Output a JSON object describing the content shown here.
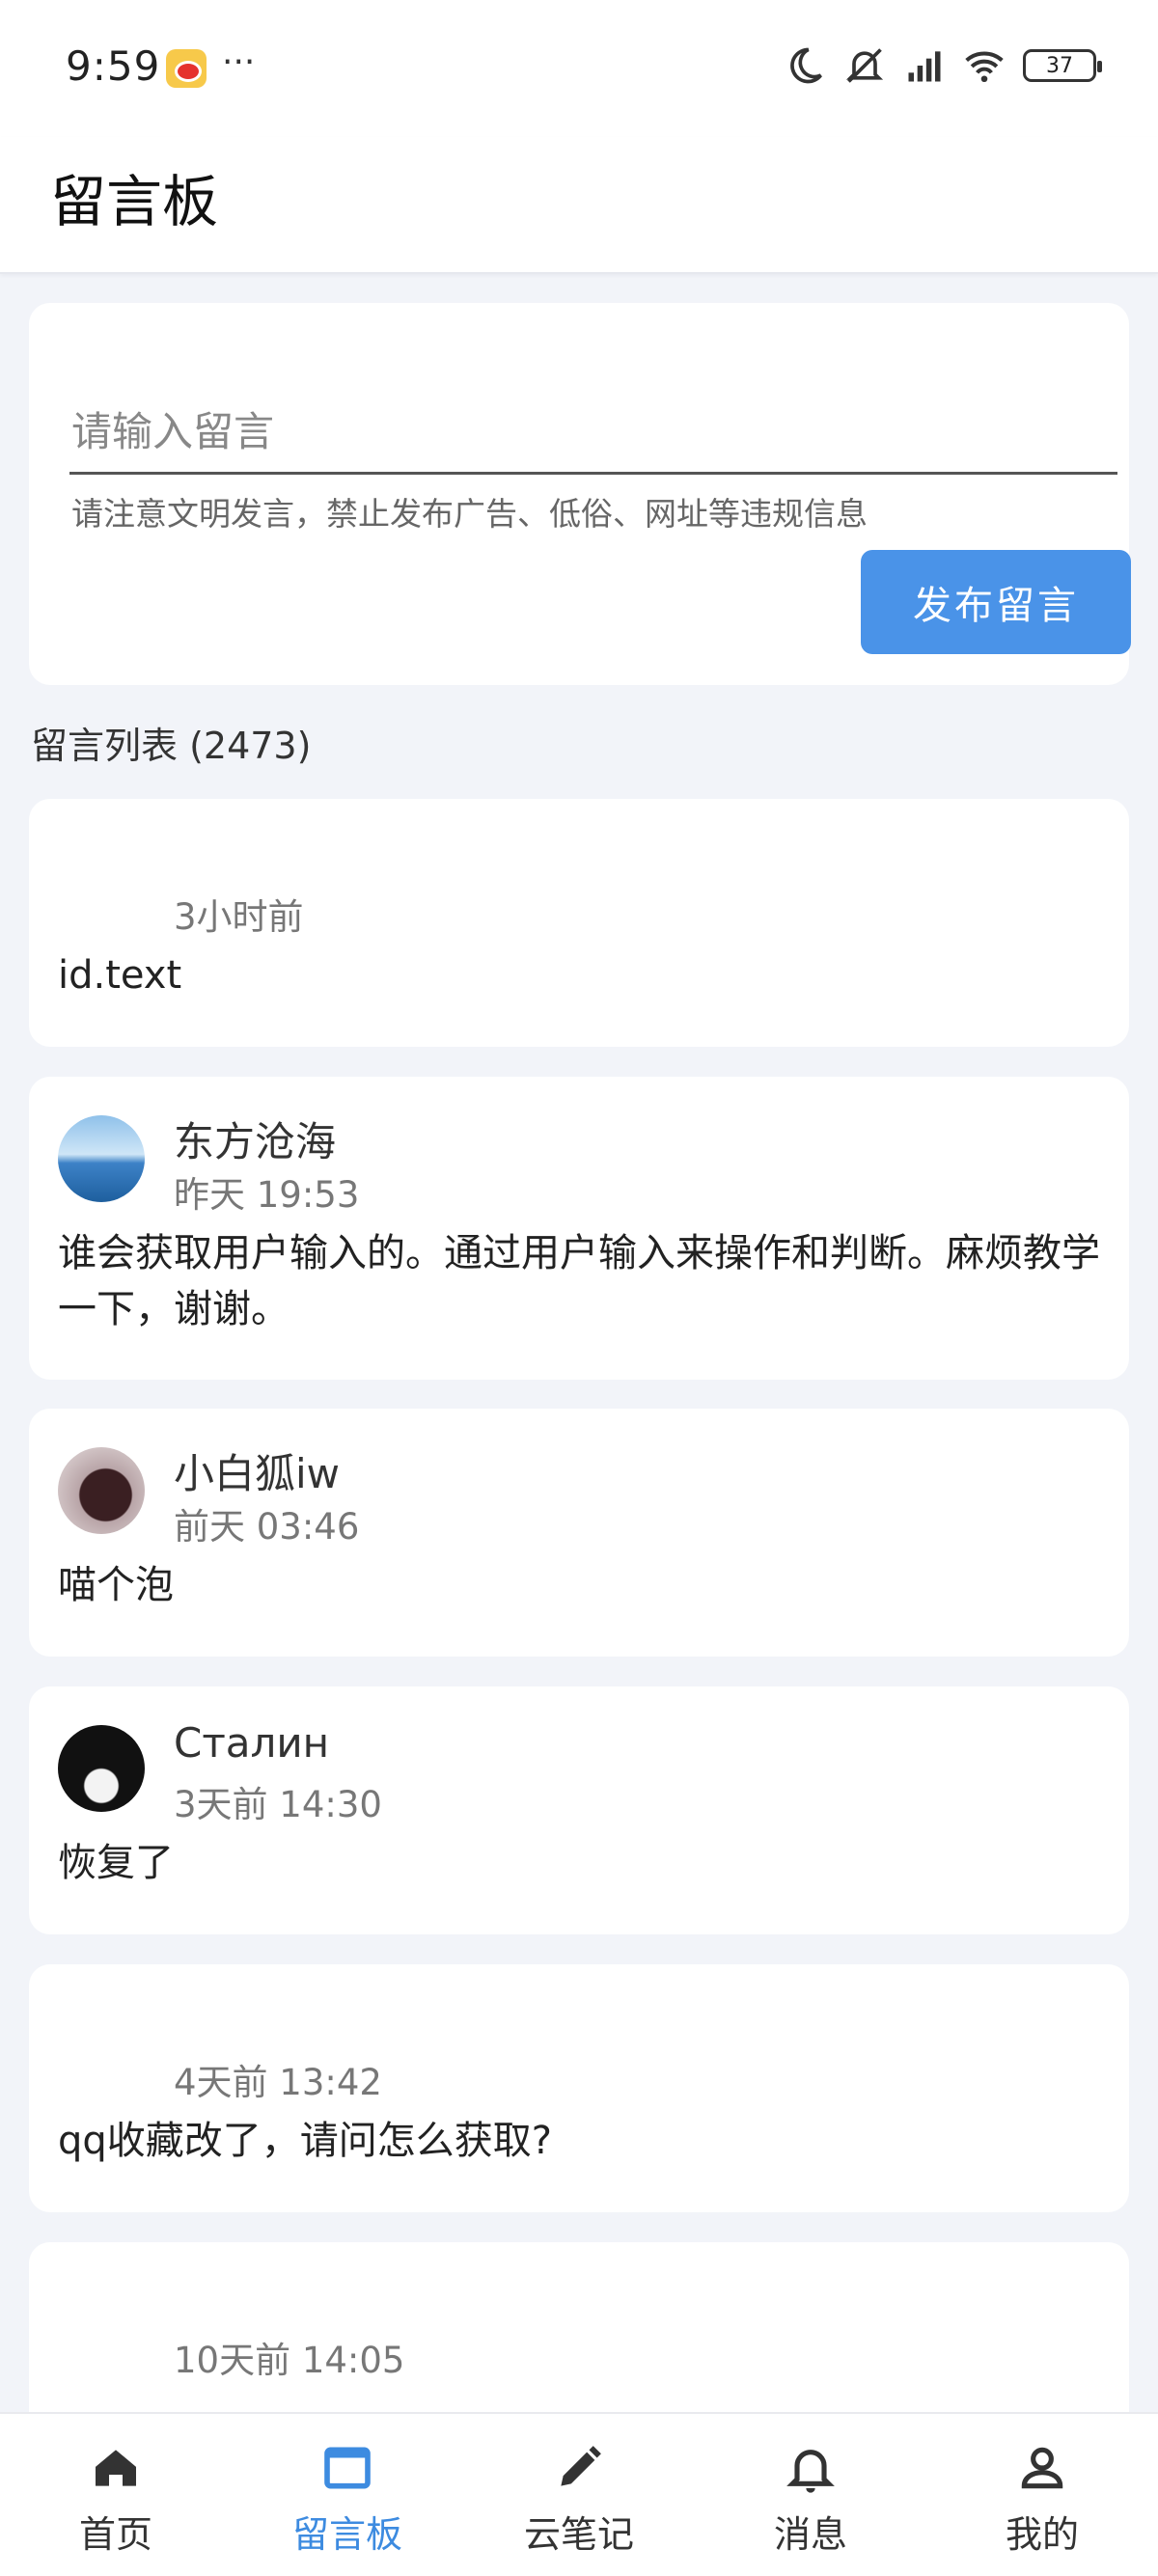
{
  "status_bar": {
    "time": "9:59",
    "dots": "···",
    "battery": "37"
  },
  "header": {
    "title": "留言板"
  },
  "compose": {
    "placeholder": "请输入留言",
    "hint": "请注意文明发言，禁止发布广告、低俗、网址等违规信息",
    "post_button": "发布留言"
  },
  "list": {
    "title": "留言列表 (2473)",
    "items": [
      {
        "author": "",
        "time": "3小时前",
        "content": "id.text"
      },
      {
        "author": "东方沧海",
        "time": "昨天 19:53",
        "content": "谁会获取用户输入的。通过用户输入来操作和判断。麻烦教学一下，谢谢。"
      },
      {
        "author": "小白狐iw",
        "time": "前天 03:46",
        "content": "喵个泡"
      },
      {
        "author": "Сталин",
        "time": "3天前 14:30",
        "content": "恢复了"
      },
      {
        "author": "",
        "time": "4天前 13:42",
        "content": "qq收藏改了，请问怎么获取?"
      },
      {
        "author": "",
        "time": "10天前 14:05",
        "content": ""
      }
    ]
  },
  "nav": {
    "items": [
      {
        "label": "首页",
        "icon": "home-icon"
      },
      {
        "label": "留言板",
        "icon": "board-icon"
      },
      {
        "label": "云笔记",
        "icon": "pencil-icon"
      },
      {
        "label": "消息",
        "icon": "bell-icon"
      },
      {
        "label": "我的",
        "icon": "person-icon"
      }
    ],
    "active_color": "#3d8be0"
  }
}
